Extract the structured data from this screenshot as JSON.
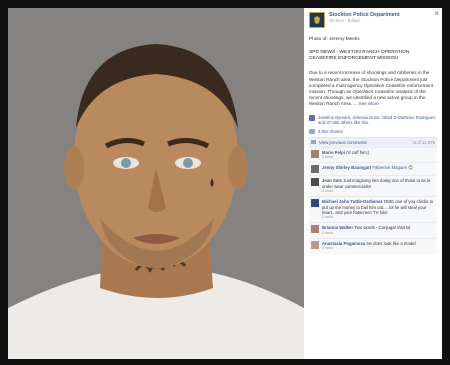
{
  "post": {
    "page_name": "Stockton Police Department",
    "timestamp": "18 June · Edited",
    "caption": "Photo of: Jeremy Meeks",
    "headline": "SPD NEWS - WESTON RANCH OPERATION CEASEFIRE ENFORCEMENT MISSION",
    "body": "Due to a recent increase of shootings and robberies in the Weston Ranch area, the Stockton Police Department just completed a multi-agency Operation Ceasefire enforcement mission. Through an Operation Ceasefire analysis of the recent shootings, we identified a new active group in the Weston Ranch Area. ...",
    "see_more": "See More",
    "likes": "Josefine Nymark, Jelessia Dunn, Obed D-Martinez Rodriguez and 37,655 others like this.",
    "shares": "4,062 shares",
    "view_previous": "View previous comments",
    "comment_count": "6 of 12,075",
    "close": "×"
  },
  "comments": [
    {
      "name": "Mario Pelpi",
      "text": "I'd cuff him;)",
      "meta": "2 mins"
    },
    {
      "name": "Jenny Shirley Baumgart",
      "text": "",
      "tag": "Fabienne Maguire",
      "meta": "",
      "emoji": "😊"
    },
    {
      "name": "Jean Sets",
      "text": "Just imagining him doing one of those in as le under wear commercials!!",
      "meta": "2 mins"
    },
    {
      "name": "Michael John Tuttle-Derbenez",
      "text": "OMG one of you chicks to put up the money to bail him out.... lol he will steal your heart.. and your flatscreen TV lolo!",
      "meta": "2 mins"
    },
    {
      "name": "Brianna Walker",
      "text": "Two words - Conjugal Visit lol",
      "meta": "2 mins"
    },
    {
      "name": "Anastasia Pogamova",
      "text": "He does look like a model",
      "meta": "2 mins"
    }
  ],
  "colors": {
    "link": "#3b5998",
    "badge": "#23364f",
    "badge_trim": "#c7a54a"
  }
}
